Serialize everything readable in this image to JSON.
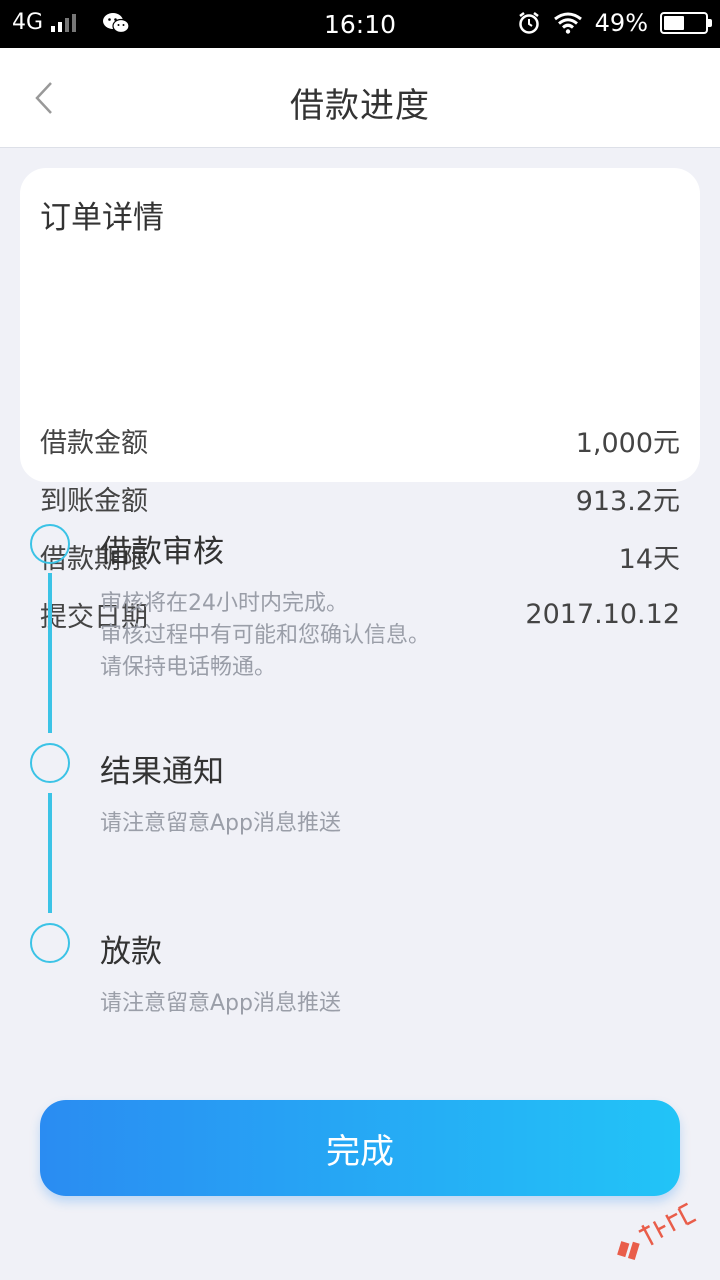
{
  "status_bar": {
    "network": "4G",
    "time": "16:10",
    "battery_percent": "49%",
    "battery_level": 0.49
  },
  "nav": {
    "title": "借款进度"
  },
  "order": {
    "title": "订单详情",
    "rows": [
      {
        "label": "借款金额",
        "value": "1,000元"
      },
      {
        "label": "到账金额",
        "value": "913.2元"
      },
      {
        "label": "借款期限",
        "value": "14天"
      },
      {
        "label": "提交日期",
        "value": "2017.10.12"
      }
    ]
  },
  "steps": [
    {
      "title": "借款审核",
      "desc": [
        "审核将在24小时内完成。",
        "审核过程中有可能和您确认信息。",
        "请保持电话畅通。"
      ]
    },
    {
      "title": "结果通知",
      "desc": [
        "请注意留意App消息推送"
      ]
    },
    {
      "title": "放款",
      "desc": [
        "请注意留意App消息推送"
      ]
    }
  ],
  "button": {
    "label": "完成"
  },
  "colors": {
    "accent": "#3bc3e6",
    "button_start": "#2a8cf2",
    "button_end": "#22c4f7"
  }
}
